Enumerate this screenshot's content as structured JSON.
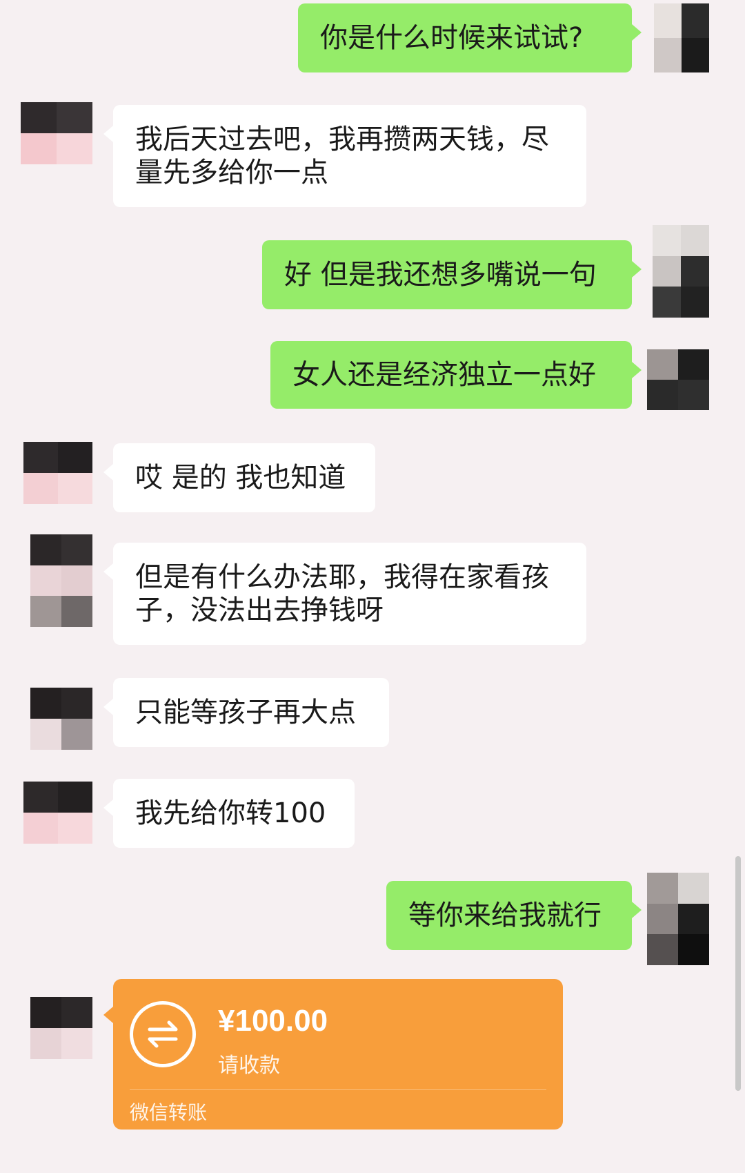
{
  "messages": [
    {
      "side": "right",
      "text": "你是什么时候来试试?"
    },
    {
      "side": "left",
      "lines": [
        "我后天过去吧，我再攒两天钱，尽",
        "量先多给你一点"
      ]
    },
    {
      "side": "right",
      "text": "好 但是我还想多嘴说一句"
    },
    {
      "side": "right",
      "text": "女人还是经济独立一点好"
    },
    {
      "side": "left",
      "text": "哎 是的 我也知道"
    },
    {
      "side": "left",
      "lines": [
        "但是有什么办法耶，我得在家看孩",
        "子，没法出去挣钱呀"
      ]
    },
    {
      "side": "left",
      "text": "只能等孩子再大点"
    },
    {
      "side": "left",
      "text": "我先给你转100"
    },
    {
      "side": "right",
      "text": "等你来给我就行"
    }
  ],
  "transfer": {
    "amount": "¥100.00",
    "status": "请收款",
    "footer": "微信转账",
    "color": "#f89e3b",
    "icon": "transfer-arrows-icon"
  },
  "colors": {
    "background": "#f6f0f2",
    "self_bubble": "#95ec69",
    "other_bubble": "#ffffff"
  }
}
